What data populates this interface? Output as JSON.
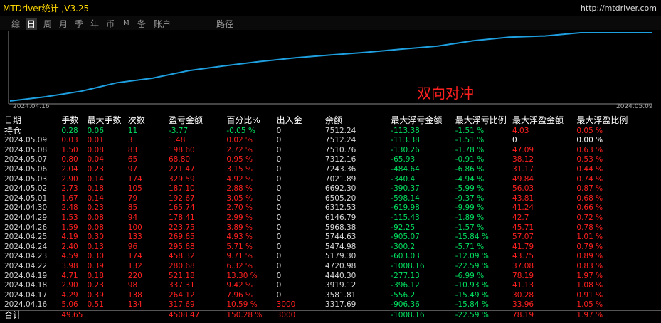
{
  "title": "MTDriver统计 ,V3.25",
  "url": "http://mtdriver.com",
  "tabs": [
    {
      "label": "综",
      "active": false,
      "small": false
    },
    {
      "label": "日",
      "active": true,
      "small": false
    },
    {
      "label": "周",
      "active": false,
      "small": false
    },
    {
      "label": "月",
      "active": false,
      "small": false
    },
    {
      "label": "季",
      "active": false,
      "small": false
    },
    {
      "label": "年",
      "active": false,
      "small": false
    },
    {
      "label": "币",
      "active": false,
      "small": false
    },
    {
      "label": "M",
      "active": false,
      "small": true
    },
    {
      "label": "备",
      "active": false,
      "small": false
    },
    {
      "label": "账户",
      "active": false,
      "small": false
    },
    {
      "label": "路径",
      "active": false,
      "small": false
    }
  ],
  "chart": {
    "start_label": "2024.04.16",
    "end_label": "2024.05.09",
    "annotation": "双向对冲",
    "line_color": "#1e9fe0",
    "balance_points": [
      3317.69,
      3581.81,
      3919.12,
      4440.3,
      4720.98,
      5179.3,
      5474.98,
      5744.63,
      5968.38,
      6146.79,
      6312.53,
      6505.2,
      6692.3,
      7021.89,
      7243.36,
      7312.16,
      7510.76,
      7512.24,
      7512.24
    ]
  },
  "headers": [
    "日期",
    "手数",
    "最大手数",
    "次数",
    "盈亏金额",
    "百分比%",
    "出入金",
    "余额",
    "最大浮亏金额",
    "最大浮亏比例",
    "最大浮盈金额",
    "最大浮盈比例"
  ],
  "position_row": [
    "持仓",
    "0.28",
    "0.06",
    "11",
    "-3.77",
    "-0.05 %",
    "0",
    "7512.24",
    "-113.38",
    "-1.51 %",
    "4.03",
    "0.05 %"
  ],
  "rows": [
    [
      "2024.05.09",
      "0.03",
      "0.01",
      "3",
      "1.48",
      "0.02 %",
      "0",
      "7512.24",
      "-113.38",
      "-1.51 %",
      "0",
      "0.00 %"
    ],
    [
      "2024.05.08",
      "1.50",
      "0.08",
      "83",
      "198.60",
      "2.72 %",
      "0",
      "7510.76",
      "-130.26",
      "-1.78 %",
      "47.09",
      "0.63 %"
    ],
    [
      "2024.05.07",
      "0.80",
      "0.04",
      "65",
      "68.80",
      "0.95 %",
      "0",
      "7312.16",
      "-65.93",
      "-0.91 %",
      "38.12",
      "0.53 %"
    ],
    [
      "2024.05.06",
      "2.04",
      "0.23",
      "97",
      "221.47",
      "3.15 %",
      "0",
      "7243.36",
      "-484.64",
      "-6.86 %",
      "31.17",
      "0.44 %"
    ],
    [
      "2024.05.03",
      "2.90",
      "0.14",
      "174",
      "329.59",
      "4.92 %",
      "0",
      "7021.89",
      "-340.4",
      "-4.94 %",
      "49.84",
      "0.74 %"
    ],
    [
      "2024.05.02",
      "2.73",
      "0.18",
      "105",
      "187.10",
      "2.88 %",
      "0",
      "6692.30",
      "-390.37",
      "-5.99 %",
      "56.03",
      "0.87 %"
    ],
    [
      "2024.05.01",
      "1.67",
      "0.14",
      "79",
      "192.67",
      "3.05 %",
      "0",
      "6505.20",
      "-598.14",
      "-9.37 %",
      "43.81",
      "0.68 %"
    ],
    [
      "2024.04.30",
      "2.48",
      "0.23",
      "85",
      "165.74",
      "2.70 %",
      "0",
      "6312.53",
      "-619.98",
      "-9.99 %",
      "41.24",
      "0.66 %"
    ],
    [
      "2024.04.29",
      "1.53",
      "0.08",
      "94",
      "178.41",
      "2.99 %",
      "0",
      "6146.79",
      "-115.43",
      "-1.89 %",
      "42.7",
      "0.72 %"
    ],
    [
      "2024.04.26",
      "1.59",
      "0.08",
      "100",
      "223.75",
      "3.89 %",
      "0",
      "5968.38",
      "-92.25",
      "-1.57 %",
      "45.71",
      "0.78 %"
    ],
    [
      "2024.04.25",
      "4.19",
      "0.30",
      "133",
      "269.65",
      "4.93 %",
      "0",
      "5744.63",
      "-905.07",
      "-15.84 %",
      "57.07",
      "1.01 %"
    ],
    [
      "2024.04.24",
      "2.40",
      "0.13",
      "96",
      "295.68",
      "5.71 %",
      "0",
      "5474.98",
      "-300.2",
      "-5.71 %",
      "41.79",
      "0.79 %"
    ],
    [
      "2024.04.23",
      "4.59",
      "0.30",
      "174",
      "458.32",
      "9.71 %",
      "0",
      "5179.30",
      "-603.03",
      "-12.09 %",
      "43.75",
      "0.89 %"
    ],
    [
      "2024.04.22",
      "3.98",
      "0.39",
      "132",
      "280.68",
      "6.32 %",
      "0",
      "4720.98",
      "-1008.16",
      "-22.59 %",
      "37.08",
      "0.83 %"
    ],
    [
      "2024.04.19",
      "4.71",
      "0.18",
      "220",
      "521.18",
      "13.30 %",
      "0",
      "4440.30",
      "-277.13",
      "-6.99 %",
      "78.19",
      "1.97 %"
    ],
    [
      "2024.04.18",
      "2.90",
      "0.23",
      "98",
      "337.31",
      "9.42 %",
      "0",
      "3919.12",
      "-396.12",
      "-10.93 %",
      "41.13",
      "1.08 %"
    ],
    [
      "2024.04.17",
      "4.29",
      "0.39",
      "138",
      "264.12",
      "7.96 %",
      "0",
      "3581.81",
      "-556.2",
      "-15.49 %",
      "30.28",
      "0.91 %"
    ],
    [
      "2024.04.16",
      "5.06",
      "0.51",
      "134",
      "317.69",
      "10.59 %",
      "3000",
      "3317.69",
      "-906.36",
      "-15.84 %",
      "33.96",
      "1.05 %"
    ]
  ],
  "total_row": [
    "合计",
    "49.65",
    "",
    "",
    "4508.47",
    "150.28 %",
    "3000",
    "",
    "-1008.16",
    "-22.59 %",
    "78.19",
    "1.97 %"
  ]
}
